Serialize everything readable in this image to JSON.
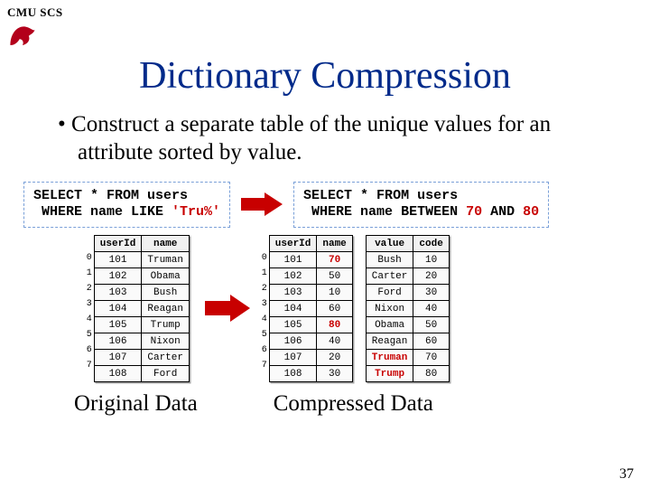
{
  "header": {
    "label": "CMU SCS"
  },
  "title": "Dictionary Compression",
  "bullet": "Construct a separate table of the unique values for an attribute sorted by value.",
  "sql_left": {
    "l1a": "SELECT * FROM users",
    "l2a": " WHERE name LIKE ",
    "l2b": "'Tru%'"
  },
  "sql_right": {
    "l1a": "SELECT * FROM users",
    "l2a": " WHERE name BETWEEN ",
    "l2b": "70",
    "l2c": " AND ",
    "l2d": "80"
  },
  "left_table": {
    "headers": [
      "userId",
      "name"
    ],
    "index": [
      "0",
      "1",
      "2",
      "3",
      "4",
      "5",
      "6",
      "7"
    ],
    "rows": [
      [
        "101",
        "Truman"
      ],
      [
        "102",
        "Obama"
      ],
      [
        "103",
        "Bush"
      ],
      [
        "104",
        "Reagan"
      ],
      [
        "105",
        "Trump"
      ],
      [
        "106",
        "Nixon"
      ],
      [
        "107",
        "Carter"
      ],
      [
        "108",
        "Ford"
      ]
    ]
  },
  "right_main": {
    "headers": [
      "userId",
      "name"
    ],
    "index": [
      "0",
      "1",
      "2",
      "3",
      "4",
      "5",
      "6",
      "7"
    ],
    "rows": [
      [
        "101",
        "70"
      ],
      [
        "102",
        "50"
      ],
      [
        "103",
        "10"
      ],
      [
        "104",
        "60"
      ],
      [
        "105",
        "80"
      ],
      [
        "106",
        "40"
      ],
      [
        "107",
        "20"
      ],
      [
        "108",
        "30"
      ]
    ],
    "red_name_indices": [
      0,
      4
    ]
  },
  "right_dict": {
    "headers": [
      "value",
      "code"
    ],
    "rows": [
      [
        "Bush",
        "10"
      ],
      [
        "Carter",
        "20"
      ],
      [
        "Ford",
        "30"
      ],
      [
        "Nixon",
        "40"
      ],
      [
        "Obama",
        "50"
      ],
      [
        "Reagan",
        "60"
      ],
      [
        "Truman",
        "70"
      ],
      [
        "Trump",
        "80"
      ]
    ],
    "red_value_indices": [
      6,
      7
    ]
  },
  "captions": {
    "left": "Original Data",
    "right": "Compressed Data"
  },
  "slide_number": "37"
}
